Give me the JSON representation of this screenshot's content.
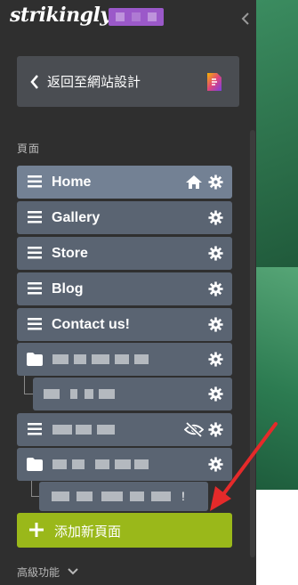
{
  "app": {
    "logo_text": "strikingly",
    "accent_color": "#9ab81a",
    "badge_color": "#9b59c9"
  },
  "back": {
    "label": "返回至網站設計",
    "icon": "chevron-left-icon",
    "site_icon": "site-file-icon"
  },
  "pages_section": {
    "label": "頁面"
  },
  "pages": [
    {
      "label": "Home",
      "type": "page",
      "icons": [
        "home-icon",
        "gear-icon"
      ]
    },
    {
      "label": "Gallery",
      "type": "page",
      "icons": [
        "gear-icon"
      ]
    },
    {
      "label": "Store",
      "type": "page",
      "icons": [
        "gear-icon"
      ]
    },
    {
      "label": "Blog",
      "type": "page",
      "icons": [
        "gear-icon"
      ]
    },
    {
      "label": "Contact us!",
      "type": "page",
      "icons": [
        "gear-icon"
      ]
    }
  ],
  "blurred_items_note": "",
  "last_sub_suffix": "!",
  "add_page": {
    "label": "添加新頁面",
    "icon": "plus-icon"
  },
  "advanced": {
    "label": "高級功能",
    "icon": "chevron-down-icon"
  },
  "colors": {
    "sidebar_bg": "#2f2f2f",
    "item_bg": "#5a6472",
    "item_active_bg": "#738194",
    "annotation_arrow": "#e52a2a"
  }
}
